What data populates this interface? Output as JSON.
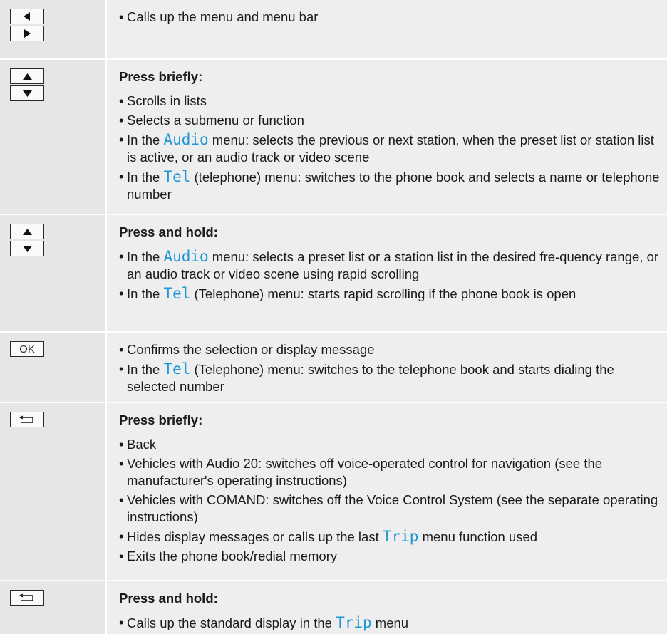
{
  "keys": {
    "ok_label": "OK"
  },
  "rows": [
    {
      "items": [
        {
          "text": "Calls up the menu and menu bar"
        }
      ]
    },
    {
      "heading": "Press briefly:",
      "items": [
        {
          "text": "Scrolls in lists"
        },
        {
          "text": "Selects a submenu or function"
        },
        {
          "pre": "In the ",
          "code": "Audio",
          "post": " menu: selects the previous or next station, when the preset list or station list is active, or an audio track or video scene"
        },
        {
          "pre": "In the ",
          "code": "Tel",
          "post": " (telephone) menu: switches to the phone book and selects a name or telephone number"
        }
      ]
    },
    {
      "heading": "Press and hold:",
      "items": [
        {
          "pre": "In the ",
          "code": "Audio",
          "post": " menu: selects a preset list or a station list in the desired fre-quency range, or an audio track or video scene using rapid scrolling"
        },
        {
          "pre": "In the ",
          "code": "Tel",
          "post": " (Telephone) menu: starts rapid scrolling if the phone book is open"
        }
      ]
    },
    {
      "items": [
        {
          "text": "Confirms the selection or display message"
        },
        {
          "pre": "In the ",
          "code": "Tel",
          "post": " (Telephone) menu: switches to the telephone book and starts dialing the selected number"
        }
      ]
    },
    {
      "heading": "Press briefly:",
      "items": [
        {
          "text": "Back"
        },
        {
          "text": "Vehicles with Audio 20: switches off voice-operated control for navigation (see the manufacturer's operating instructions)"
        },
        {
          "text": "Vehicles with COMAND: switches off the Voice Control System (see the separate operating instructions)"
        },
        {
          "pre": "Hides display messages or calls up the last ",
          "code": "Trip",
          "post": " menu function used"
        },
        {
          "text": "Exits the phone book/redial memory"
        }
      ]
    },
    {
      "heading": "Press and hold:",
      "items": [
        {
          "pre": "Calls up the standard display in the ",
          "code": "Trip",
          "post": " menu"
        }
      ]
    }
  ]
}
